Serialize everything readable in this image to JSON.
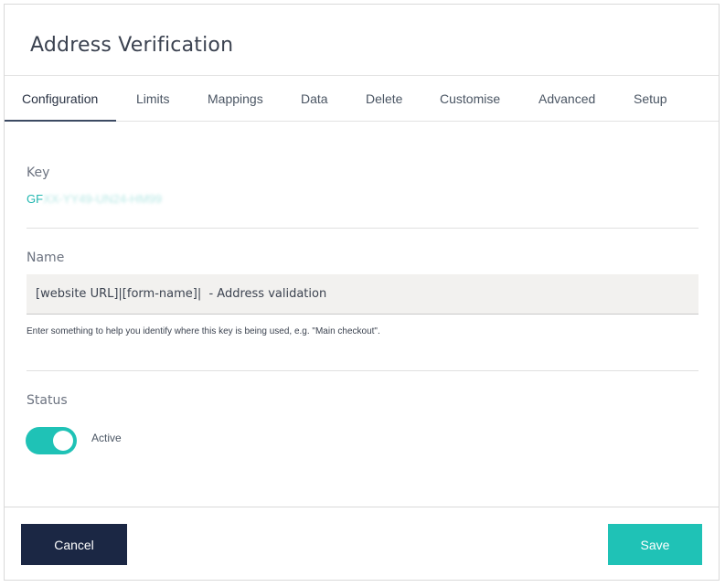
{
  "dialog": {
    "title": "Address Verification"
  },
  "tabs": [
    {
      "label": "Configuration",
      "active": true
    },
    {
      "label": "Limits"
    },
    {
      "label": "Mappings"
    },
    {
      "label": "Data"
    },
    {
      "label": "Delete"
    },
    {
      "label": "Customise"
    },
    {
      "label": "Advanced"
    },
    {
      "label": "Setup"
    }
  ],
  "key": {
    "label": "Key",
    "value_prefix": "GF",
    "value_obscured": "XX-YY49-UN24-HM99"
  },
  "name": {
    "label": "Name",
    "value": "[website URL]|[form-name]|  - Address validation",
    "help": "Enter something to help you identify where this key is being used, e.g. \"Main checkout\"."
  },
  "status": {
    "label": "Status",
    "toggle_on": true,
    "state_label": "Active"
  },
  "footer": {
    "cancel_label": "Cancel",
    "save_label": "Save"
  },
  "colors": {
    "accent": "#1fc2b6",
    "primary_dark": "#1b2744",
    "key_text": "#22b7b0"
  }
}
